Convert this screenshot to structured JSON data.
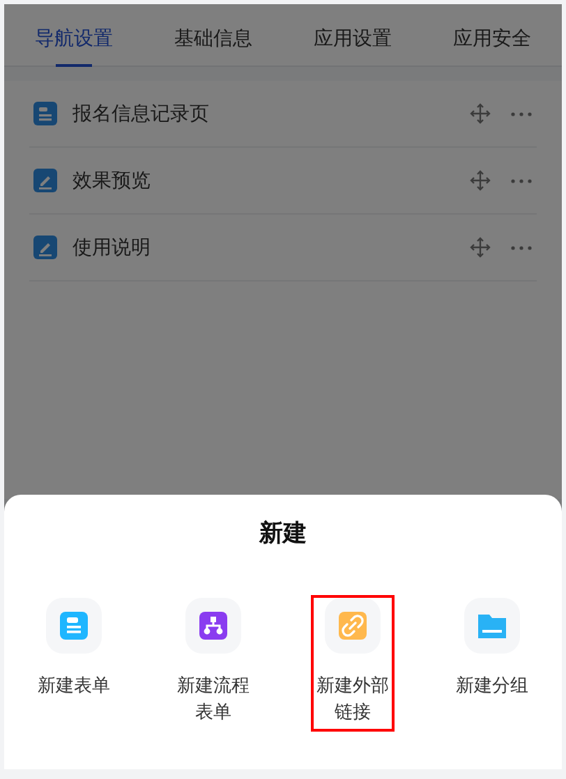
{
  "tabs": [
    {
      "label": "导航设置",
      "selected": true
    },
    {
      "label": "基础信息",
      "selected": false
    },
    {
      "label": "应用设置",
      "selected": false
    },
    {
      "label": "应用安全",
      "selected": false
    }
  ],
  "nav_items": [
    {
      "kind": "form",
      "label": "报名信息记录页"
    },
    {
      "kind": "page",
      "label": "效果预览"
    },
    {
      "kind": "page",
      "label": "使用说明"
    }
  ],
  "sheet": {
    "title": "新建",
    "options": [
      {
        "kind": "form",
        "label": "新建表单",
        "highlighted": false
      },
      {
        "kind": "flow",
        "label": "新建流程表单",
        "highlighted": false
      },
      {
        "kind": "link",
        "label": "新建外部链接",
        "highlighted": true
      },
      {
        "kind": "folder",
        "label": "新建分组",
        "highlighted": false
      }
    ]
  }
}
